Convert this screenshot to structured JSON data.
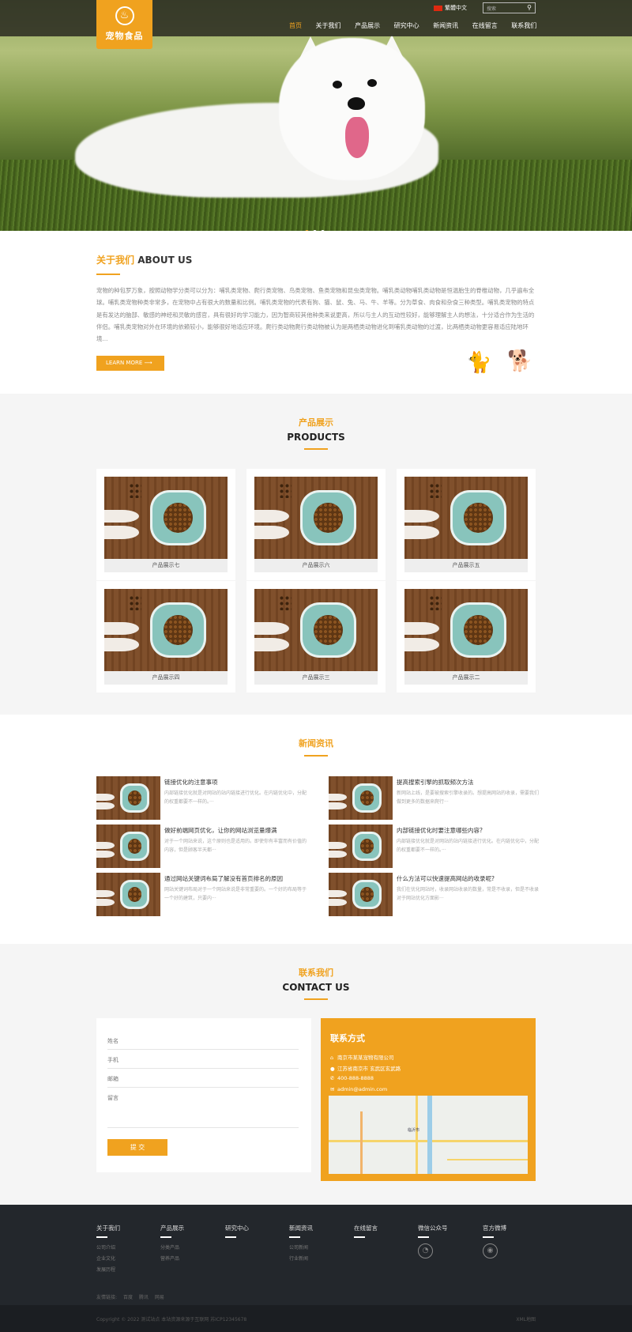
{
  "header": {
    "logo_text": "宠物食品",
    "language": "繁體中文",
    "search_placeholder": "搜索",
    "nav": [
      "首页",
      "关于我们",
      "产品展示",
      "研究中心",
      "新闻资讯",
      "在线留言",
      "联系我们"
    ],
    "active_nav": "首页"
  },
  "banner": {
    "slides": 3,
    "active_slide": 1
  },
  "about": {
    "title_cn": "关于我们",
    "title_en": "ABOUT US",
    "text": "宠物的种包罗万象，按照动物学分类可以分为：哺乳类宠物、爬行类宠物、鸟类宠物、鱼类宠物和昆虫类宠物。哺乳类动物哺乳类动物是恒温胎生的脊椎动物，几乎遍布全球。哺乳类宠物种类非常多，在宠物中占有很大的数量和比例。哺乳类宠物的代表有狗、猫、鼠、兔、马、牛、羊等。分为草食、肉食和杂食三种类型。哺乳类宠物的特点是有发达的脑部、敏感的神经和灵敏的感官，具有很好的学习能力，因为智商较其他种类来说更高，所以与主人的互动性较好，能够理解主人的想法，十分适合作为生活的伴侣。哺乳类宠物对外在环境的依赖较小，能够很好地适应环境。爬行类动物爬行类动物被认为是两栖类动物进化到哺乳类动物的过渡，比两栖类动物更容易适应陆地环境...",
    "button": "LEARN MORE"
  },
  "products": {
    "title_cn": "产品展示",
    "title_en": "PRODUCTS",
    "items": [
      {
        "caption": "产品展示七"
      },
      {
        "caption": "产品展示六"
      },
      {
        "caption": "产品展示五"
      },
      {
        "caption": "产品展示四"
      },
      {
        "caption": "产品展示三"
      },
      {
        "caption": "产品展示二"
      }
    ]
  },
  "news": {
    "title_cn": "新闻资讯",
    "items": [
      {
        "title": "链接优化的注意事项",
        "desc": "内部链接优化就是对网站的站内链接进行优化。在内链优化中，分配的权重都要不一样的。···"
      },
      {
        "title": "提高搜索引擎的抓取频次方法",
        "desc": "新网站上线，是要被搜索引擎收录的。想提高网站的收录，需要我们做到更多的数据来爬行···"
      },
      {
        "title": "做好前端网页优化，让你的网站浏览量爆满",
        "desc": "对于一个网站来说，这个原则也是适用的。即使你有丰富而有价值的内容，但是顾客半天都···"
      },
      {
        "title": "内部链接优化时要注意哪些内容?",
        "desc": "内部链接优化就是对网站的站内链接进行优化。在内链优化中，分配的权重都要不一样的。···"
      },
      {
        "title": "通过网站关键词布局了解没有首页排名的原因",
        "desc": "网站关键词布局对于一个网站来说是非常重要的。一个好的布局等于一个好的建筑，只要内···"
      },
      {
        "title": "什么方法可以快速提高网站的收录呢?",
        "desc": "我们在优化网站时，收录网站收录的数量，常是不收录，但是不收录对于网站优化方面影···"
      }
    ]
  },
  "contact": {
    "title_cn": "联系我们",
    "title_en": "CONTACT US",
    "form": {
      "name": "姓名",
      "phone": "手机",
      "email": "邮箱",
      "message": "留言",
      "submit": "提 交"
    },
    "info": {
      "heading": "联系方式",
      "company": "南京市某某宠物有限公司",
      "address": "江苏省南京市 玄武区玄武路",
      "phone": "400-888-8888",
      "email": "admin@admin.com"
    },
    "map_labels": [
      "临沂市"
    ]
  },
  "footer": {
    "columns": [
      {
        "head": "关于我们",
        "links": [
          "公司介绍",
          "企业文化",
          "发展历程"
        ]
      },
      {
        "head": "产品展示",
        "links": [
          "分类产品",
          "营养产品"
        ]
      },
      {
        "head": "研究中心",
        "links": []
      },
      {
        "head": "新闻资讯",
        "links": [
          "公司新闻",
          "行业新闻"
        ]
      },
      {
        "head": "在线留言",
        "links": []
      },
      {
        "head": "微信公众号",
        "links": []
      },
      {
        "head": "官方微博",
        "links": []
      }
    ],
    "friend_links_label": "友情链接:",
    "friend_links": [
      "百度",
      "腾讯",
      "网易"
    ],
    "copyright": "Copyright © 2022 测试站点 本站资源来源于互联网 苏ICP12345678",
    "sitemap": "XML地图"
  }
}
